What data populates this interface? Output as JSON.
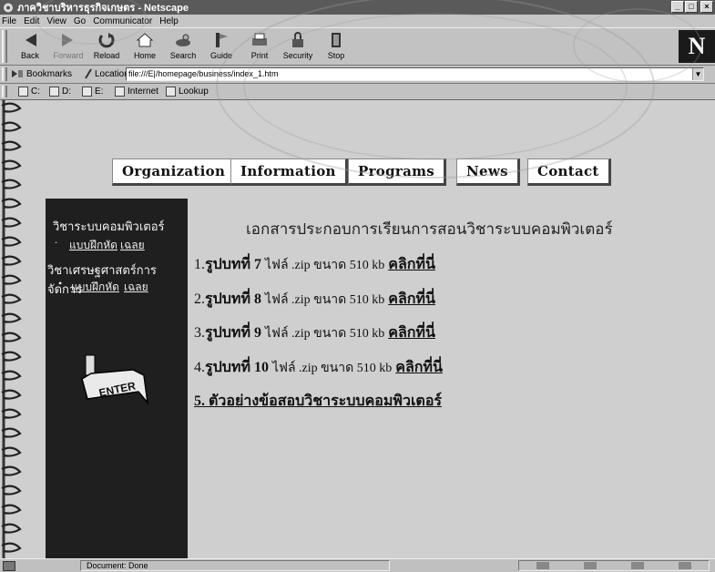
{
  "window": {
    "title": "ภาควิชาบริหารธุรกิจเกษตร - Netscape",
    "buttons": {
      "minimize": "_",
      "maximize": "□",
      "close": "×"
    }
  },
  "menu": [
    "File",
    "Edit",
    "View",
    "Go",
    "Communicator",
    "Help"
  ],
  "toolbar": {
    "buttons": [
      {
        "label": "Back",
        "icon": "back-arrow-icon"
      },
      {
        "label": "Forward",
        "icon": "forward-arrow-icon"
      },
      {
        "label": "Reload",
        "icon": "reload-icon"
      },
      {
        "label": "Home",
        "icon": "home-icon"
      },
      {
        "label": "Search",
        "icon": "search-icon"
      },
      {
        "label": "Guide",
        "icon": "guide-icon"
      },
      {
        "label": "Print",
        "icon": "print-icon"
      },
      {
        "label": "Security",
        "icon": "security-lock-icon"
      },
      {
        "label": "Stop",
        "icon": "stop-icon"
      }
    ],
    "logo": "N"
  },
  "location": {
    "bookmarks_label": "Bookmarks",
    "location_label": "Location",
    "url": "file:///E|/homepage/business/index_1.htm"
  },
  "personal": {
    "items": [
      "C:",
      "D:",
      "E:",
      "Internet",
      "Lookup"
    ]
  },
  "nav": {
    "tabs": [
      "Organization",
      "Information",
      "Programs",
      "News",
      "Contact"
    ]
  },
  "sidebar": {
    "course1": "วิชาระบบคอมพิวเตอร์",
    "course1_link1": "แบบฝึกหัด",
    "course1_link2": "เฉลย",
    "course2": "วิชาเศรษฐศาสตร์การจัดการ",
    "course2_link1": "แบบฝึกหัด",
    "course2_link2": "เฉลย",
    "enter_label": "ENTER"
  },
  "main": {
    "heading": "เอกสารประกอบการเรียนการสอนวิชาระบบคอมพิวเตอร์",
    "items": [
      {
        "prefix": "1.",
        "title": "รูปบทที่ 7",
        "file": "ไฟล์ .zip ขนาด 510 kb",
        "link": "คลิกที่นี่"
      },
      {
        "prefix": "2.",
        "title": "รูปบทที่ 8",
        "file": "ไฟล์ .zip ขนาด 510 kb",
        "link": "คลิกที่นี่"
      },
      {
        "prefix": "3.",
        "title": "รูปบทที่ 9",
        "file": "ไฟล์ .zip ขนาด 510 kb",
        "link": "คลิกที่นี่"
      },
      {
        "prefix": "4.",
        "title": "รูปบทที่ 10",
        "file": "ไฟล์ .zip ขนาด 510 kb",
        "link": "คลิกที่นี่"
      }
    ],
    "sample_link": "5. ตัวอย่างข้อสอบวิชาระบบคอมพิวเตอร์"
  },
  "status": {
    "text": "Document: Done"
  },
  "colors": {
    "sidebar_bg": "#1f1f1f",
    "page_bg": "#cfcfcf",
    "titlebar_bg": "#5a5a5a"
  }
}
